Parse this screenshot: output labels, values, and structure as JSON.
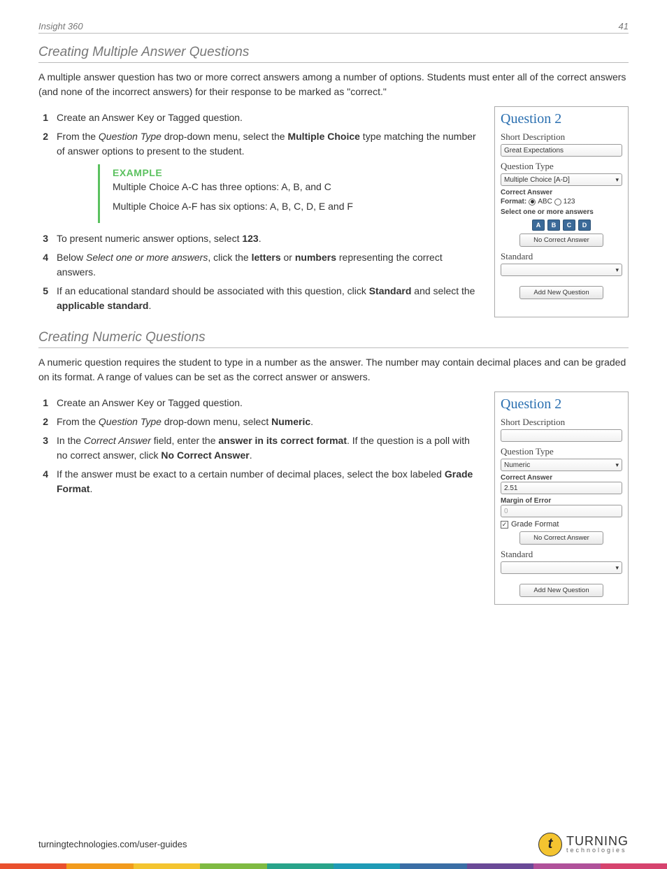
{
  "header": {
    "product": "Insight 360",
    "page_number": "41"
  },
  "section1": {
    "title": "Creating Multiple Answer Questions",
    "intro": "A multiple answer question has two or more correct answers among a number of options. Students must enter all of the correct answers (and none of the incorrect answers) for their response to be marked as \"correct.\"",
    "steps": {
      "s1": "Create an Answer Key or Tagged question.",
      "s2a": "From the ",
      "s2b": "Question Type",
      "s2c": " drop-down menu, select the ",
      "s2d": "Multiple Choice",
      "s2e": " type matching the number of answer options to present to the student.",
      "s3a": "To present numeric answer options, select ",
      "s3b": "123",
      "s3c": ".",
      "s4a": "Below ",
      "s4b": "Select one or more answers",
      "s4c": ", click the ",
      "s4d": "letters",
      "s4e": " or ",
      "s4f": "numbers",
      "s4g": " representing the correct answers.",
      "s5a": "If an educational standard should be associated with this question, click ",
      "s5b": "Standard",
      "s5c": " and select the ",
      "s5d": "applicable standard",
      "s5e": "."
    },
    "example": {
      "label": "EXAMPLE",
      "line1": "Multiple Choice A-C has three options: A, B, and C",
      "line2": "Multiple Choice A-F has six options: A, B, C, D, E and F"
    },
    "panel": {
      "title": "Question 2",
      "short_desc_label": "Short Description",
      "short_desc_value": "Great Expectations",
      "qtype_label": "Question Type",
      "qtype_value": "Multiple Choice [A-D]",
      "correct_label": "Correct Answer",
      "format_label": "Format:",
      "fmt_abc": "ABC",
      "fmt_123": "123",
      "select_label": "Select one or more answers",
      "ans_a": "A",
      "ans_b": "B",
      "ans_c": "C",
      "ans_d": "D",
      "no_correct": "No Correct Answer",
      "standard_label": "Standard",
      "add_btn": "Add New Question"
    }
  },
  "section2": {
    "title": "Creating Numeric Questions",
    "intro": "A numeric question requires the student to type in a number as the answer. The number may contain decimal places and can be graded on its format. A range of values can be set as the correct answer or answers.",
    "steps": {
      "s1": "Create an Answer Key or Tagged question.",
      "s2a": "From the ",
      "s2b": "Question Type",
      "s2c": " drop-down menu, select ",
      "s2d": "Numeric",
      "s2e": ".",
      "s3a": "In the ",
      "s3b": "Correct Answer",
      "s3c": " field, enter the ",
      "s3d": "answer in its correct format",
      "s3e": ". If the question is a poll with no correct answer, click ",
      "s3f": "No Correct Answer",
      "s3g": ".",
      "s4a": "If the answer must be exact to a certain number of decimal places, select the box labeled ",
      "s4b": "Grade Format",
      "s4c": "."
    },
    "panel": {
      "title": "Question 2",
      "short_desc_label": "Short Description",
      "short_desc_value": "",
      "qtype_label": "Question Type",
      "qtype_value": "Numeric",
      "correct_label": "Correct Answer",
      "correct_value": "2.51",
      "margin_label": "Margin of Error",
      "margin_value": "0",
      "grade_fmt": "Grade Format",
      "no_correct": "No Correct Answer",
      "standard_label": "Standard",
      "add_btn": "Add New Question"
    }
  },
  "footer": {
    "url": "turningtechnologies.com/user-guides",
    "brand1": "TURNING",
    "brand2": "technologies"
  },
  "strip_colors": [
    "#e9502e",
    "#f29b1d",
    "#f4c430",
    "#7fba42",
    "#28a38a",
    "#1f9bb6",
    "#3a6ea5",
    "#6a4a97",
    "#b0519a",
    "#d6436e"
  ]
}
